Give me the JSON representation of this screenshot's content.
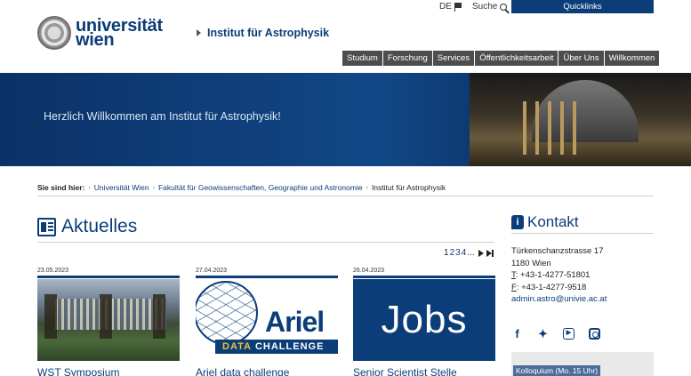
{
  "header": {
    "logo_line1": "universität",
    "logo_line2": "wien",
    "institute": "Institut für Astrophysik",
    "lang": "DE",
    "search_label": "Suche",
    "quicklinks": "Quicklinks"
  },
  "nav": {
    "items": [
      "Studium",
      "Forschung",
      "Services",
      "Öffentlichkeitsarbeit",
      "Über Uns",
      "Willkommen"
    ]
  },
  "hero": {
    "title": "Herzlich Willkommen am Institut für Astrophysik!"
  },
  "breadcrumb": {
    "label": "Sie sind hier:",
    "items": [
      "Universität Wien",
      "Fakultät für Geowissenschaften, Geographie und Astronomie",
      "Institut für Astrophysik"
    ]
  },
  "news": {
    "heading": "Aktuelles",
    "pager": {
      "current": "1",
      "pages": [
        "2",
        "3",
        "4"
      ],
      "ellipsis": "..."
    },
    "items": [
      {
        "date": "23.05.2023",
        "title": "WST Symposium"
      },
      {
        "date": "27.04.2023",
        "title": "Ariel data challenge",
        "image_word": "Ariel",
        "image_band_a": "DATA",
        "image_band_b": " CHALLENGE"
      },
      {
        "date": "26.04.2023",
        "title": "Senior Scientist Stelle",
        "image_text": "Jobs"
      }
    ]
  },
  "contact": {
    "heading": "Kontakt",
    "street": "Türkenschanzstrasse 17",
    "city": "1180 Wien",
    "tel_label": "T",
    "tel": ": +43-1-4277-51801",
    "fax_label": "F",
    "fax": ": +43-1-4277-9518",
    "email": "admin.astro@univie.ac.at",
    "kolloquium": "Kolloquium (Mo. 15 Uhr)"
  },
  "colors": {
    "brand": "#0b3d78",
    "nav_bg": "#4d4d4d"
  }
}
